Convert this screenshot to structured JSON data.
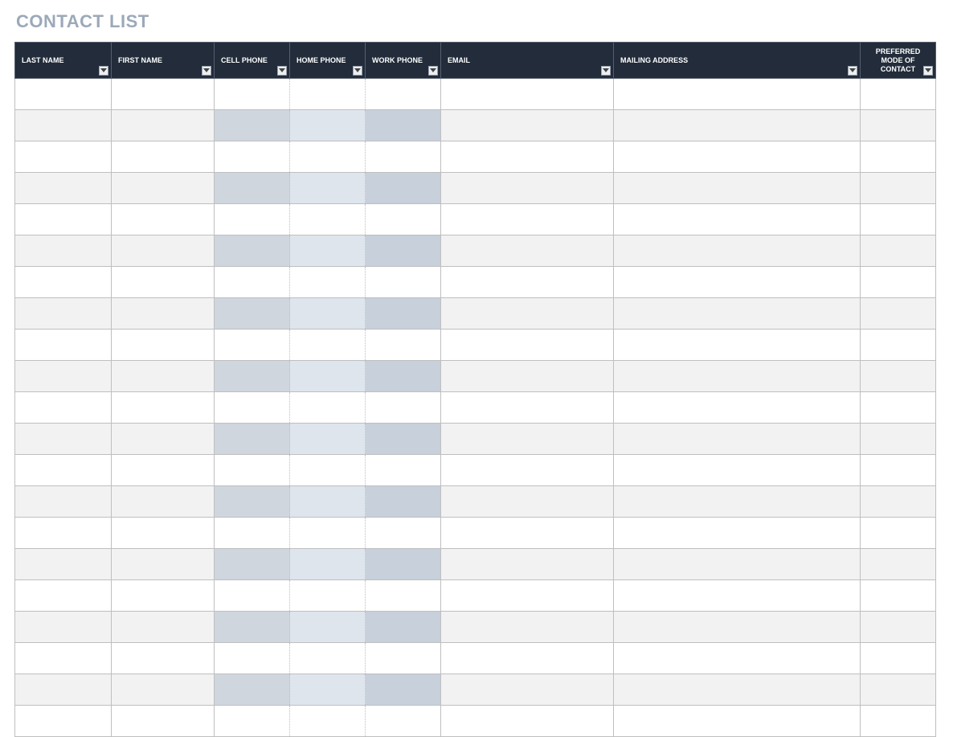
{
  "title": "CONTACT LIST",
  "columns": {
    "last_name": "LAST NAME",
    "first_name": "FIRST NAME",
    "cell_phone": "CELL PHONE",
    "home_phone": "HOME PHONE",
    "work_phone": "WORK PHONE",
    "email": "EMAIL",
    "mailing": "MAILING ADDRESS",
    "preferred": "PREFERRED MODE OF CONTACT"
  },
  "rows": [
    {
      "last_name": "",
      "first_name": "",
      "cell_phone": "",
      "home_phone": "",
      "work_phone": "",
      "email": "",
      "mailing": "",
      "preferred": ""
    },
    {
      "last_name": "",
      "first_name": "",
      "cell_phone": "",
      "home_phone": "",
      "work_phone": "",
      "email": "",
      "mailing": "",
      "preferred": ""
    },
    {
      "last_name": "",
      "first_name": "",
      "cell_phone": "",
      "home_phone": "",
      "work_phone": "",
      "email": "",
      "mailing": "",
      "preferred": ""
    },
    {
      "last_name": "",
      "first_name": "",
      "cell_phone": "",
      "home_phone": "",
      "work_phone": "",
      "email": "",
      "mailing": "",
      "preferred": ""
    },
    {
      "last_name": "",
      "first_name": "",
      "cell_phone": "",
      "home_phone": "",
      "work_phone": "",
      "email": "",
      "mailing": "",
      "preferred": ""
    },
    {
      "last_name": "",
      "first_name": "",
      "cell_phone": "",
      "home_phone": "",
      "work_phone": "",
      "email": "",
      "mailing": "",
      "preferred": ""
    },
    {
      "last_name": "",
      "first_name": "",
      "cell_phone": "",
      "home_phone": "",
      "work_phone": "",
      "email": "",
      "mailing": "",
      "preferred": ""
    },
    {
      "last_name": "",
      "first_name": "",
      "cell_phone": "",
      "home_phone": "",
      "work_phone": "",
      "email": "",
      "mailing": "",
      "preferred": ""
    },
    {
      "last_name": "",
      "first_name": "",
      "cell_phone": "",
      "home_phone": "",
      "work_phone": "",
      "email": "",
      "mailing": "",
      "preferred": ""
    },
    {
      "last_name": "",
      "first_name": "",
      "cell_phone": "",
      "home_phone": "",
      "work_phone": "",
      "email": "",
      "mailing": "",
      "preferred": ""
    },
    {
      "last_name": "",
      "first_name": "",
      "cell_phone": "",
      "home_phone": "",
      "work_phone": "",
      "email": "",
      "mailing": "",
      "preferred": ""
    },
    {
      "last_name": "",
      "first_name": "",
      "cell_phone": "",
      "home_phone": "",
      "work_phone": "",
      "email": "",
      "mailing": "",
      "preferred": ""
    },
    {
      "last_name": "",
      "first_name": "",
      "cell_phone": "",
      "home_phone": "",
      "work_phone": "",
      "email": "",
      "mailing": "",
      "preferred": ""
    },
    {
      "last_name": "",
      "first_name": "",
      "cell_phone": "",
      "home_phone": "",
      "work_phone": "",
      "email": "",
      "mailing": "",
      "preferred": ""
    },
    {
      "last_name": "",
      "first_name": "",
      "cell_phone": "",
      "home_phone": "",
      "work_phone": "",
      "email": "",
      "mailing": "",
      "preferred": ""
    },
    {
      "last_name": "",
      "first_name": "",
      "cell_phone": "",
      "home_phone": "",
      "work_phone": "",
      "email": "",
      "mailing": "",
      "preferred": ""
    },
    {
      "last_name": "",
      "first_name": "",
      "cell_phone": "",
      "home_phone": "",
      "work_phone": "",
      "email": "",
      "mailing": "",
      "preferred": ""
    },
    {
      "last_name": "",
      "first_name": "",
      "cell_phone": "",
      "home_phone": "",
      "work_phone": "",
      "email": "",
      "mailing": "",
      "preferred": ""
    },
    {
      "last_name": "",
      "first_name": "",
      "cell_phone": "",
      "home_phone": "",
      "work_phone": "",
      "email": "",
      "mailing": "",
      "preferred": ""
    },
    {
      "last_name": "",
      "first_name": "",
      "cell_phone": "",
      "home_phone": "",
      "work_phone": "",
      "email": "",
      "mailing": "",
      "preferred": ""
    },
    {
      "last_name": "",
      "first_name": "",
      "cell_phone": "",
      "home_phone": "",
      "work_phone": "",
      "email": "",
      "mailing": "",
      "preferred": ""
    }
  ]
}
